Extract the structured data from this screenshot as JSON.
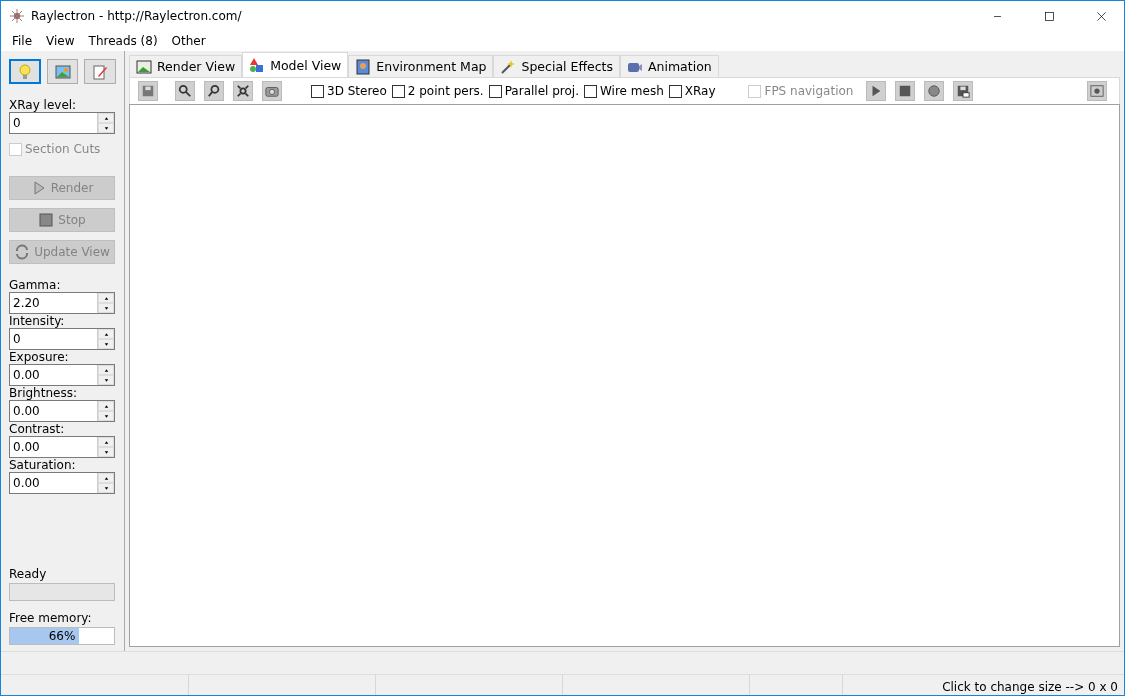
{
  "window": {
    "title": "Raylectron - http://Raylectron.com/"
  },
  "menu": [
    "File",
    "View",
    "Threads (8)",
    "Other"
  ],
  "sidebar": {
    "modes": [
      {
        "kind": "bulb",
        "selected": true
      },
      {
        "kind": "image",
        "selected": false
      },
      {
        "kind": "edit",
        "selected": false
      }
    ],
    "xray": {
      "label": "XRay level:",
      "value": "0"
    },
    "section_cuts": {
      "label": "Section Cuts",
      "checked": false,
      "disabled": true
    },
    "actions": [
      {
        "kind": "render",
        "label": "Render",
        "disabled": true
      },
      {
        "kind": "stop",
        "label": "Stop",
        "disabled": true
      },
      {
        "kind": "update",
        "label": "Update View",
        "disabled": true
      }
    ],
    "adjustments": [
      {
        "label": "Gamma:",
        "value": "2.20"
      },
      {
        "label": "Intensity:",
        "value": "0"
      },
      {
        "label": "Exposure:",
        "value": "0.00"
      },
      {
        "label": "Brightness:",
        "value": "0.00"
      },
      {
        "label": "Contrast:",
        "value": "0.00"
      },
      {
        "label": "Saturation:",
        "value": "0.00"
      }
    ],
    "status": {
      "label": "Ready",
      "level": 0
    },
    "memory": {
      "label": "Free memory:",
      "level": 0.66,
      "reading": "66%"
    }
  },
  "tabs": [
    {
      "kind": "render",
      "label": "Render View",
      "selected": false
    },
    {
      "kind": "model",
      "label": "Model View",
      "selected": true
    },
    {
      "kind": "env",
      "label": "Environment Map",
      "selected": false
    },
    {
      "kind": "fx",
      "label": "Special Effects",
      "selected": false
    },
    {
      "kind": "anim",
      "label": "Animation",
      "selected": false
    }
  ],
  "toolbar": {
    "options": [
      {
        "label": "3D Stereo",
        "checked": false,
        "disabled": false
      },
      {
        "label": "2 point pers.",
        "checked": false,
        "disabled": false
      },
      {
        "label": "Parallel proj.",
        "checked": false,
        "disabled": false
      },
      {
        "label": "Wire mesh",
        "checked": false,
        "disabled": false
      },
      {
        "label": "XRay",
        "checked": false,
        "disabled": false
      },
      {
        "label": "FPS navigation",
        "checked": false,
        "disabled": true
      }
    ]
  },
  "status_bar": {
    "text": "Click to change size --> 0 x 0"
  }
}
